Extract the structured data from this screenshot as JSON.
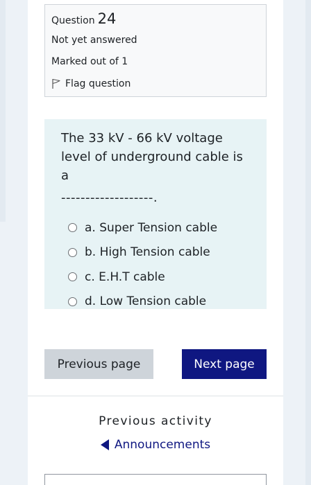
{
  "question_info": {
    "label": "Question",
    "number": "24",
    "status": "Not yet answered",
    "marks": "Marked out of 1",
    "flag_label": "Flag question"
  },
  "question": {
    "text": "The 33 kV - 66 kV voltage level of underground cable is a",
    "blank": "-------------------.",
    "answers": [
      {
        "letter": "a.",
        "text": "Super Tension cable"
      },
      {
        "letter": "b.",
        "text": "High Tension cable"
      },
      {
        "letter": "c.",
        "text": "E.H.T cable"
      },
      {
        "letter": "d.",
        "text": "Low Tension cable"
      }
    ]
  },
  "navigation": {
    "previous_label": "Previous page",
    "next_label": "Next page"
  },
  "activity_nav": {
    "previous_activity_label": "Previous activity",
    "previous_activity_link": "Announcements"
  },
  "colors": {
    "accent": "#0f1781",
    "question_bg": "#e7f3f5",
    "info_bg": "#f8f9fa",
    "secondary_button": "#ced4da"
  }
}
